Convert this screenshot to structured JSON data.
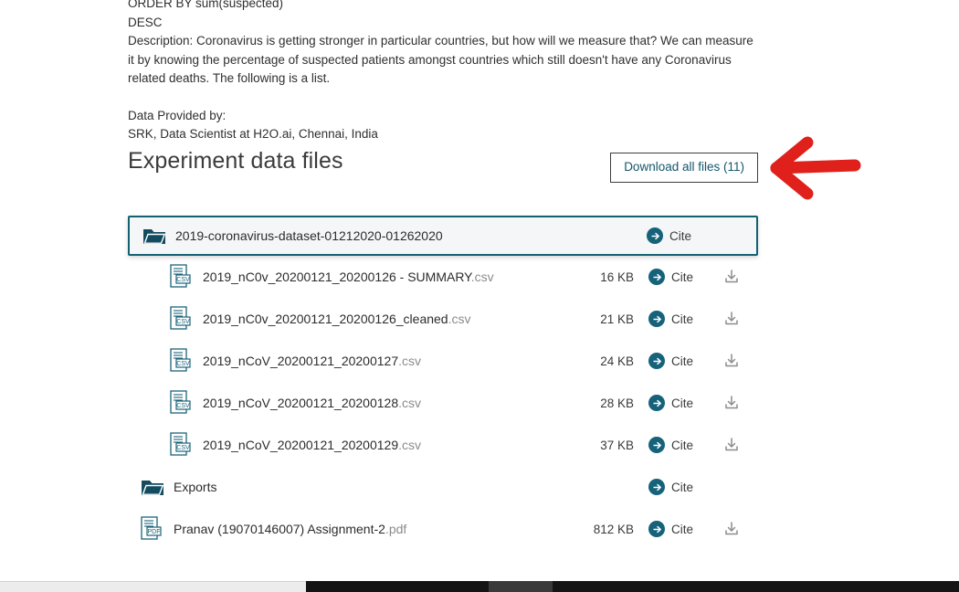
{
  "description": {
    "lines": [
      "ORDER BY sum(suspected)",
      "DESC",
      "Description: Coronavirus is getting stronger in particular countries, but how will we measure that? We can measure it by knowing the percentage of suspected patients amongst countries which still doesn't have any Coronavirus related deaths. The following is a list."
    ],
    "provider_label": "Data Provided by:",
    "provider_value": "SRK, Data Scientist at H2O.ai, Chennai, India"
  },
  "section": {
    "title": "Experiment data files",
    "download_all_label": "Download all files (11)"
  },
  "annotation": {
    "arrow_color": "#e0201b",
    "arrow_direction": "left",
    "points_to": "Download all files (11)"
  },
  "colors": {
    "accent_teal": "#15627a",
    "selected_border": "#126272",
    "selected_background": "#f4f6f7",
    "folder_icon": "#134b5f",
    "file_icon_outline": "#1b6479",
    "download_icon": "#8c8c8c",
    "extension_text": "#8b8b8b"
  },
  "file_rows": [
    {
      "type": "folder",
      "icon": "folder-icon",
      "name": "2019-coronavirus-dataset-01212020-01262020",
      "extension": "",
      "size": "",
      "cite_label": "Cite",
      "has_download": false,
      "selected": true,
      "indent": false
    },
    {
      "type": "file",
      "icon": "csv-file-icon",
      "name": "2019_nC0v_20200121_20200126 - SUMMARY",
      "extension": ".csv",
      "size": "16 KB",
      "cite_label": "Cite",
      "has_download": true,
      "selected": false,
      "indent": true
    },
    {
      "type": "file",
      "icon": "csv-file-icon",
      "name": "2019_nC0v_20200121_20200126_cleaned",
      "extension": ".csv",
      "size": "21 KB",
      "cite_label": "Cite",
      "has_download": true,
      "selected": false,
      "indent": true
    },
    {
      "type": "file",
      "icon": "csv-file-icon",
      "name": "2019_nCoV_20200121_20200127",
      "extension": ".csv",
      "size": "24 KB",
      "cite_label": "Cite",
      "has_download": true,
      "selected": false,
      "indent": true
    },
    {
      "type": "file",
      "icon": "csv-file-icon",
      "name": "2019_nCoV_20200121_20200128",
      "extension": ".csv",
      "size": "28 KB",
      "cite_label": "Cite",
      "has_download": true,
      "selected": false,
      "indent": true
    },
    {
      "type": "file",
      "icon": "csv-file-icon",
      "name": "2019_nCoV_20200121_20200129",
      "extension": ".csv",
      "size": "37 KB",
      "cite_label": "Cite",
      "has_download": true,
      "selected": false,
      "indent": true
    },
    {
      "type": "folder",
      "icon": "folder-icon",
      "name": "Exports",
      "extension": "",
      "size": "",
      "cite_label": "Cite",
      "has_download": false,
      "selected": false,
      "indent": false
    },
    {
      "type": "file",
      "icon": "pdf-file-icon",
      "name": "Pranav (19070146007) Assignment-2",
      "extension": ".pdf",
      "size": "812 KB",
      "cite_label": "Cite",
      "has_download": true,
      "selected": false,
      "indent": false
    }
  ]
}
